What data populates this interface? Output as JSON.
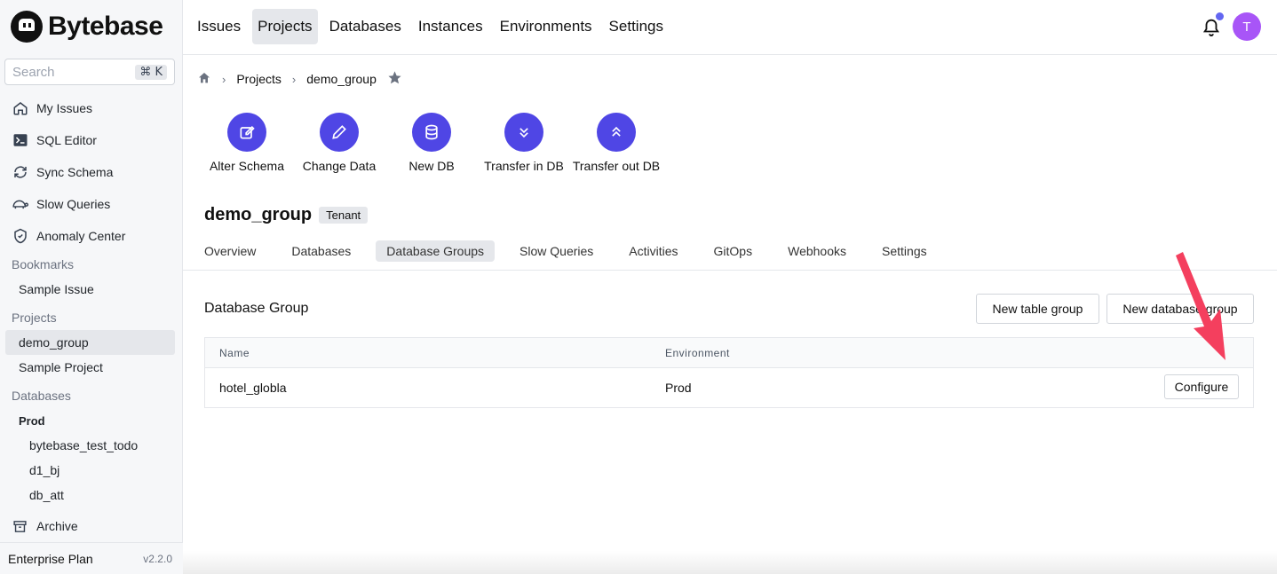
{
  "app": {
    "name": "Bytebase"
  },
  "sidebar": {
    "search_placeholder": "Search",
    "search_shortcut": "⌘ K",
    "items": [
      {
        "label": "My Issues",
        "icon": "home-icon"
      },
      {
        "label": "SQL Editor",
        "icon": "terminal-icon"
      },
      {
        "label": "Sync Schema",
        "icon": "sync-icon"
      },
      {
        "label": "Slow Queries",
        "icon": "turtle-icon"
      },
      {
        "label": "Anomaly Center",
        "icon": "shield-icon"
      }
    ],
    "bookmarks_label": "Bookmarks",
    "bookmarks": [
      "Sample Issue"
    ],
    "projects_label": "Projects",
    "projects": [
      "demo_group",
      "Sample Project"
    ],
    "databases_label": "Databases",
    "db_env": "Prod",
    "databases": [
      "bytebase_test_todo",
      "d1_bj",
      "db_att"
    ],
    "archive_label": "Archive",
    "plan": "Enterprise Plan",
    "version": "v2.2.0"
  },
  "topnav": {
    "items": [
      "Issues",
      "Projects",
      "Databases",
      "Instances",
      "Environments",
      "Settings"
    ],
    "active": "Projects",
    "avatar_initial": "T"
  },
  "breadcrumb": {
    "projects": "Projects",
    "current": "demo_group"
  },
  "quick_actions": [
    "Alter Schema",
    "Change Data",
    "New DB",
    "Transfer in DB",
    "Transfer out DB"
  ],
  "project": {
    "name": "demo_group",
    "badge": "Tenant"
  },
  "tabs": [
    "Overview",
    "Databases",
    "Database Groups",
    "Slow Queries",
    "Activities",
    "GitOps",
    "Webhooks",
    "Settings"
  ],
  "active_tab": "Database Groups",
  "database_group": {
    "title": "Database Group",
    "new_table_group": "New table group",
    "new_database_group": "New database group",
    "columns": [
      "Name",
      "Environment"
    ],
    "rows": [
      {
        "name": "hotel_globla",
        "environment": "Prod",
        "action": "Configure"
      }
    ]
  },
  "colors": {
    "accent": "#4f46e5",
    "avatar": "#a855f7",
    "arrow": "#f43f5e",
    "notification_dot": "#6366f1"
  }
}
